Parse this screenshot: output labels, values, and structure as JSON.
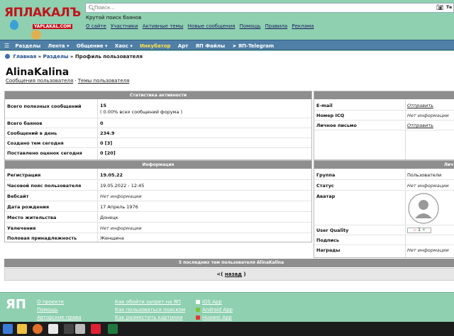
{
  "header": {
    "logo_text": "ЯПЛАКАЛЪ",
    "logo_sub": "YAPLAKAL.COM",
    "search_placeholder": "Поиск...",
    "search_trailing": "Те",
    "tagline": "Крутой поиск баянов",
    "links": [
      "О сайте",
      "Участники",
      "Активные темы",
      "Новые сообщения",
      "Помощь",
      "Правила",
      "Реклама"
    ]
  },
  "menu": {
    "items": [
      {
        "label": "Разделы",
        "highlight": false
      },
      {
        "label": "Лента ▾",
        "highlight": false
      },
      {
        "label": "Общение ▾",
        "highlight": false
      },
      {
        "label": "Хаос ▾",
        "highlight": false
      },
      {
        "label": "Инкубатор",
        "highlight": true
      },
      {
        "label": "Арт",
        "highlight": false
      },
      {
        "label": "ЯП Файлы",
        "highlight": false
      },
      {
        "label": "ЯП-Telegram",
        "highlight": false
      }
    ]
  },
  "breadcrumb": {
    "home": "Главная",
    "sep": "»",
    "sections": "Разделы",
    "current": "Профиль пользователя"
  },
  "profile": {
    "username": "AlinaKalina",
    "link_posts": "Сообщения пользователя",
    "link_sep": "·",
    "link_topics": "Темы пользователя"
  },
  "stats": {
    "title": "Статистика активности",
    "rows": [
      {
        "label": "Всего полезных сообщений",
        "value": "15",
        "sub": "( 0.00% всех сообщений форума )"
      },
      {
        "label": "Всего баянов",
        "value": "0"
      },
      {
        "label": "Сообщений в день",
        "value": "234.9"
      },
      {
        "label": "Создано тем сегодня",
        "value": "0 [3]"
      },
      {
        "label": "Поставлено оценок сегодня",
        "value": "0 [20]"
      }
    ]
  },
  "contacts": {
    "rows": [
      {
        "label": "E-mail",
        "value": "Отправить",
        "link": true
      },
      {
        "label": "Номер ICQ",
        "value": "Нет информации",
        "link": false
      },
      {
        "label": "Личное письмо",
        "value": "Отправить",
        "link": true
      }
    ]
  },
  "info": {
    "title": "Информация",
    "rows": [
      {
        "label": "Регистрация",
        "value": "19.05.22",
        "bold": true
      },
      {
        "label": "Часовой пояс пользователя",
        "value": "19.05.2022 - 12:45"
      },
      {
        "label": "Вебсайт",
        "value": "Нет информации",
        "italic": true
      },
      {
        "label": "Дата рождения",
        "value": "17 Апрель 1976"
      },
      {
        "label": "Место жительства",
        "value": "Донецк"
      },
      {
        "label": "Увлечения",
        "value": "Нет информации",
        "italic": true
      },
      {
        "label": "Половая принадлежность",
        "value": "Женщина"
      }
    ]
  },
  "personal": {
    "title_partial": "Лич",
    "rows": [
      {
        "label": "Группа",
        "value": "Пользователи"
      },
      {
        "label": "Статус",
        "value": "Нет информации",
        "italic": true
      },
      {
        "label": "Аватар",
        "value": ""
      },
      {
        "label": "User Quality",
        "value": "1"
      },
      {
        "label": "Подпись",
        "value": ""
      },
      {
        "label": "Награды",
        "value": "Нет информации",
        "italic": true
      }
    ]
  },
  "last_topics_title": "5 последних тем пользователя AlinaKalina",
  "back": {
    "prefix": "<(",
    "link": "назад",
    "suffix": ")"
  },
  "footer": {
    "logo": "ЯП",
    "col1": [
      "О проекте",
      "Помощь",
      "Авторские права"
    ],
    "col2": [
      "Как обойти запрет на ЯП",
      "Как пользоваться поиском",
      "Как разместить картинки"
    ],
    "col3": [
      "iOS App",
      "Android App",
      "Huawei App"
    ]
  },
  "colors": {
    "accent": "#4f7fa6",
    "brand_red": "#c0141c",
    "bg": "#8fd0b0",
    "panel_header": "#8e8e8e"
  }
}
